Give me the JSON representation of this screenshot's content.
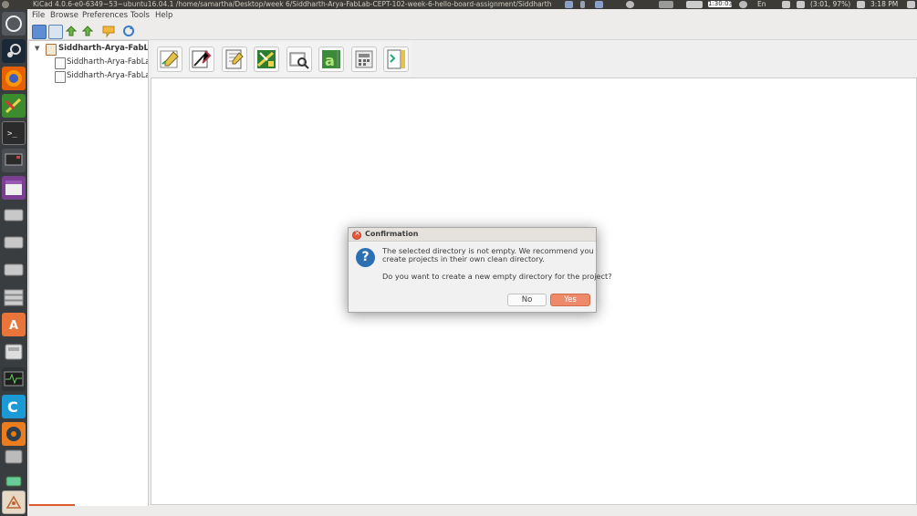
{
  "top_panel": {
    "window_title": "KiCad 4.0.6-e0-6349~53~ubuntu16.04.1 /home/samartha/Desktop/week 6/Siddharth-Arya-FabLab-CEPT-102-week-6-hello-board-assignment/Siddharth",
    "clock_badge": "1:30:03",
    "keyboard": "En",
    "battery": "(3:01, 97%)",
    "time": "3:18 PM"
  },
  "menubar": {
    "items": [
      "File",
      "Browse",
      "Preferences",
      "Tools",
      "Help"
    ]
  },
  "project_tree": {
    "root": "Siddharth-Arya-FabLab-",
    "children": [
      "Siddharth-Arya-FabLab-",
      "Siddharth-Arya-FabLab-"
    ]
  },
  "dialog": {
    "title": "Confirmation",
    "message_line1": "The selected directory is not empty.  We recommend you",
    "message_line2": "create projects in their own clean directory.",
    "question": "Do you want to create a new empty directory for the project?",
    "no_label": "No",
    "yes_label": "Yes"
  },
  "colors": {
    "accent": "#ee8969",
    "launcher_bg": "#3a3d40",
    "top_panel_bg": "#3c3b37",
    "question_icon": "#2c6fb3"
  },
  "icons": {
    "launcher": [
      "ubuntu-dash-icon",
      "steam-icon",
      "firefox-icon",
      "kicad-pcbnew-icon",
      "terminal-icon",
      "monitor-icon",
      "screenshot-icon",
      "drive-icon",
      "drive-icon",
      "drive-icon",
      "drive-stack-icon",
      "software-center-icon",
      "disk-icon",
      "system-monitor-icon",
      "cura-icon",
      "blender-icon",
      "usb-icon",
      "kicad-icon"
    ],
    "toolstrip": [
      "new-project-icon",
      "open-project-icon",
      "save-project-icon",
      "archive-icon",
      "comment-icon",
      "refresh-icon"
    ],
    "big_tools": [
      "eeschema-icon",
      "library-editor-icon",
      "pcbnew-icon",
      "footprint-editor-icon",
      "gerbview-icon",
      "bitmap2component-icon",
      "pcb-calculator-icon",
      "page-layout-editor-icon"
    ]
  }
}
